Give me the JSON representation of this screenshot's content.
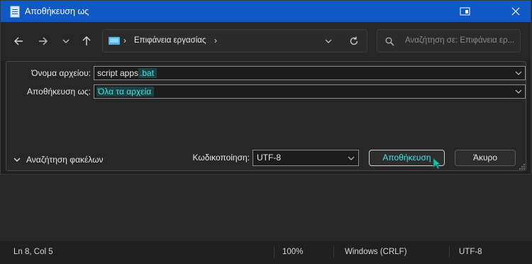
{
  "dialog": {
    "title": "Αποθήκευση ως",
    "address": {
      "path_item": "Επιφάνεια εργασίας"
    },
    "search": {
      "placeholder": "Αναζήτηση σε: Επιφάνεια ερ..."
    },
    "filename": {
      "label": "Όνομα αρχείου:",
      "value_base": "script apps",
      "value_selected": ".bat"
    },
    "savetype": {
      "label": "Αποθήκευση ως:",
      "value": "Όλα τα αρχεία"
    },
    "browse_folders": "Αναζήτηση φακέλων",
    "encoding": {
      "label": "Κωδικοποίηση:",
      "value": "UTF-8"
    },
    "save_button": "Αποθήκευση",
    "cancel_button": "Άκυρο"
  },
  "statusbar": {
    "position": "Ln 8, Col 5",
    "zoom": "100%",
    "line_ending": "Windows (CRLF)",
    "encoding": "UTF-8"
  },
  "colors": {
    "titlebar": "#0f59c4",
    "accent_text": "#3ee6e6"
  },
  "icons": [
    "notepad-icon",
    "snap-icon",
    "close-icon",
    "back-icon",
    "forward-icon",
    "recent-chevron-icon",
    "up-icon",
    "desktop-icon",
    "address-dropdown-icon",
    "refresh-icon",
    "search-icon",
    "resize-grip-icon",
    "cursor-icon"
  ]
}
